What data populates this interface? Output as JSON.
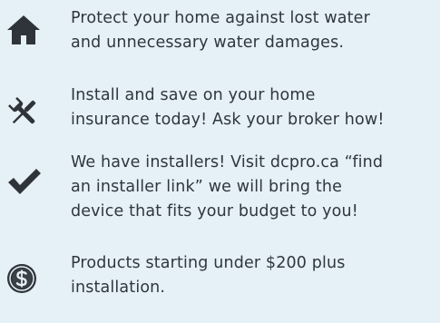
{
  "features": [
    {
      "icon": "home-icon",
      "lines": [
        "Protect your home against lost water",
        "and unnecessary water damages."
      ]
    },
    {
      "icon": "tools-icon",
      "lines": [
        "Install and save on your home",
        "insurance today! Ask your broker how!"
      ]
    },
    {
      "icon": "checkmark-icon",
      "lines": [
        "We have installers! Visit dcpro.ca “find",
        "an installer link” we will bring the",
        "device that fits your budget to you!"
      ]
    },
    {
      "icon": "dollar-coin-icon",
      "lines": [
        "Products starting under $200 plus",
        "installation."
      ]
    }
  ],
  "colors": {
    "background": "#e6f0f7",
    "text": "#2f3640",
    "icon": "#2e3439"
  }
}
